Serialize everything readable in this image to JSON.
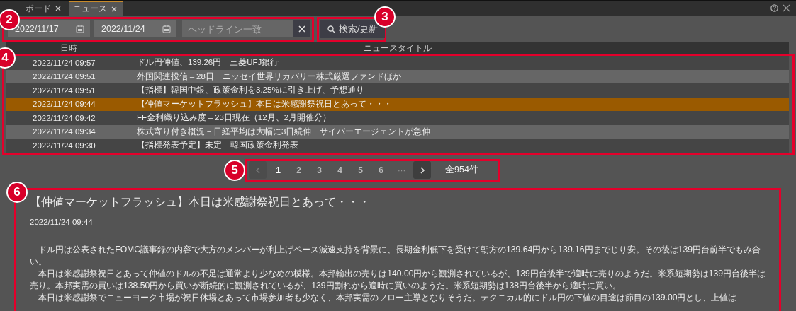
{
  "tabs": [
    {
      "label": "ボード",
      "selected": false
    },
    {
      "label": "ニュース",
      "selected": true
    }
  ],
  "filters": {
    "callout": "2",
    "date_from": "2022/11/17",
    "date_to": "2022/11/24",
    "headline": {
      "placeholder": "ヘッドライン一致"
    }
  },
  "search_button": {
    "callout": "3",
    "label": "検索/更新"
  },
  "table": {
    "columns": [
      "日時",
      "ニュースタイトル"
    ],
    "callout": "4",
    "rows": [
      {
        "time": "2022/11/24 09:57",
        "title": "ドル円仲値、139.26円　三菱UFJ銀行",
        "selected": false
      },
      {
        "time": "2022/11/24 09:51",
        "title": "外国関連投信＝28日　ニッセイ世界リカバリー株式厳選ファンドほか",
        "selected": false
      },
      {
        "time": "2022/11/24 09:51",
        "title": "【指標】韓国中銀、政策金利を3.25%に引き上げ、予想通り",
        "selected": false
      },
      {
        "time": "2022/11/24 09:44",
        "title": "【仲値マーケットフラッシュ】本日は米感謝祭祝日とあって・・・",
        "selected": true
      },
      {
        "time": "2022/11/24 09:42",
        "title": "FF金利織り込み度＝23日現在（12月、2月開催分）",
        "selected": false
      },
      {
        "time": "2022/11/24 09:34",
        "title": "株式寄り付き概況－日経平均は大幅に3日続伸　サイバーエージェントが急伸",
        "selected": false
      },
      {
        "time": "2022/11/24 09:30",
        "title": "【指標発表予定】未定　韓国政策金利発表",
        "selected": false
      }
    ]
  },
  "pager": {
    "callout": "5",
    "prev": {
      "disabled": true
    },
    "next": {
      "disabled": false
    },
    "pages": [
      {
        "label": "1",
        "selected": true
      },
      {
        "label": "2",
        "selected": false
      },
      {
        "label": "3",
        "selected": false
      },
      {
        "label": "4",
        "selected": false
      },
      {
        "label": "5",
        "selected": false
      },
      {
        "label": "6",
        "selected": false
      }
    ],
    "ellipsis": "···",
    "total": "全954件"
  },
  "detail": {
    "callout": "6",
    "title": "【仲値マーケットフラッシュ】本日は米感謝祭祝日とあって・・・",
    "time": "2022/11/24 09:44",
    "paragraphs": [
      "ドル円は公表されたFOMC議事録の内容で大方のメンバーが利上げペース減速支持を背景に、長期金利低下を受けて朝方の139.64円から139.16円までじり安。その後は139円台前半でもみ合い。",
      "本日は米感謝祭祝日とあって仲値のドルの不足は通常より少なめの模様。本邦輸出の売りは140.00円から観測されているが、139円台後半で適時に売りのようだ。米系短期勢は139円台後半は売り。本邦実需の買いは138.50円から買いが断続的に観測されているが、139円割れから適時に買いのようだ。米系短期勢は138円台後半から適時に買い。",
      "本日は米感謝祭でニューヨーク市場が祝日休場とあって市場参加者も少なく、本邦実需のフロー主導となりそうだ。テクニカル的にドル円の下値の目途は節目の139.00円とし、上値は"
    ]
  }
}
